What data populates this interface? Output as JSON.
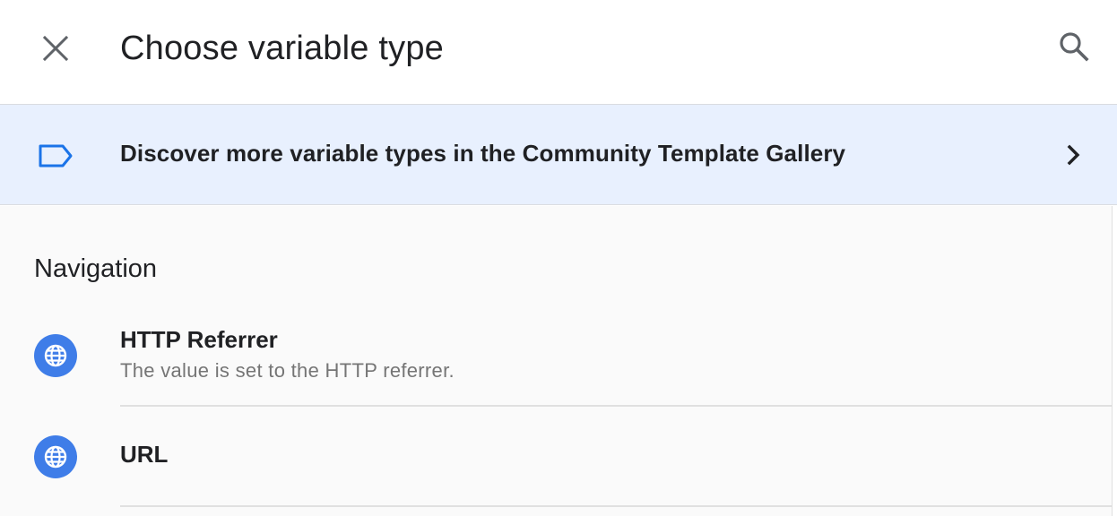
{
  "header": {
    "title": "Choose variable type",
    "close_icon": "close-icon",
    "search_icon": "search-icon"
  },
  "banner": {
    "text": "Discover more variable types in the Community Template Gallery",
    "icon": "tag-icon",
    "chevron": "chevron-right-icon",
    "background": "#e8f0fe",
    "icon_color": "#1a73e8"
  },
  "sections": [
    {
      "title": "Navigation",
      "items": [
        {
          "title": "HTTP Referrer",
          "description": "The value is set to the HTTP referrer.",
          "icon": "globe-icon"
        },
        {
          "title": "URL",
          "description": "",
          "icon": "globe-icon"
        }
      ]
    }
  ],
  "colors": {
    "accent": "#3f7de8",
    "text_primary": "#202124",
    "text_secondary": "#757575",
    "divider": "#e0e0e0"
  }
}
